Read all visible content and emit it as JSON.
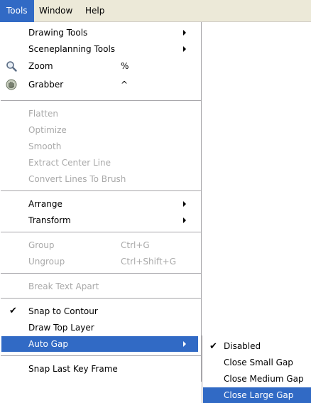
{
  "menubar": {
    "items": [
      {
        "label": "Tools",
        "active": true
      },
      {
        "label": "Window",
        "active": false
      },
      {
        "label": "Help",
        "active": false
      }
    ]
  },
  "menu": {
    "drawing_tools": "Drawing Tools",
    "sceneplanning_tools": "Sceneplanning Tools",
    "zoom": "Zoom",
    "zoom_shortcut": "%",
    "grabber": "Grabber",
    "grabber_shortcut": "^",
    "flatten": "Flatten",
    "optimize": "Optimize",
    "smooth": "Smooth",
    "extract_center_line": "Extract Center Line",
    "convert_lines_to_brush": "Convert Lines To Brush",
    "arrange": "Arrange",
    "transform": "Transform",
    "group": "Group",
    "group_shortcut": "Ctrl+G",
    "ungroup": "Ungroup",
    "ungroup_shortcut": "Ctrl+Shift+G",
    "break_text_apart": "Break Text Apart",
    "snap_to_contour": "Snap to Contour",
    "snap_to_contour_checked": true,
    "draw_top_layer": "Draw Top Layer",
    "auto_gap": "Auto Gap",
    "snap_last_key_frame": "Snap Last Key Frame"
  },
  "submenu": {
    "disabled": "Disabled",
    "disabled_checked": true,
    "close_small_gap": "Close Small Gap",
    "close_medium_gap": "Close Medium Gap",
    "close_large_gap": "Close Large Gap"
  },
  "icons": {
    "zoom": "magnifier-icon",
    "grabber": "hand-icon",
    "check": "checkmark-icon",
    "submenu_arrow": "triangle-right-icon"
  },
  "colors": {
    "menubar_bg": "#ece9d8",
    "highlight": "#316ac5",
    "disabled_text": "#a9a9a9",
    "separator": "#a7a6aa"
  }
}
